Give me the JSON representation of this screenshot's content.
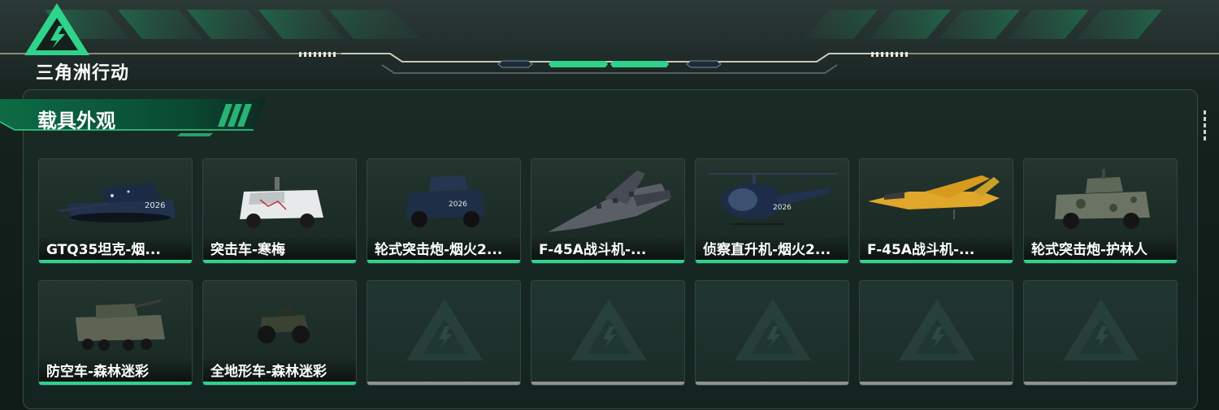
{
  "header": {
    "game_logo_text": "三角洲行动",
    "logo_icon": "delta-triangle-logo-icon"
  },
  "panel": {
    "title": "载具外观"
  },
  "vehicles": [
    {
      "name": "GTQ35坦克-烟...",
      "icon": "tank-icon"
    },
    {
      "name": "突击车-寒梅",
      "icon": "assault-vehicle-icon"
    },
    {
      "name": "轮式突击炮-烟火2...",
      "icon": "wheeled-assault-gun-icon"
    },
    {
      "name": "F-45A战斗机-...",
      "icon": "fighter-jet-icon"
    },
    {
      "name": "侦察直升机-烟火2...",
      "icon": "helicopter-icon"
    },
    {
      "name": "F-45A战斗机-...",
      "icon": "fighter-jet-yellow-icon"
    },
    {
      "name": "轮式突击炮-护林人",
      "icon": "wheeled-assault-gun-camo-icon"
    },
    {
      "name": "防空车-森林迷彩",
      "icon": "anti-air-vehicle-icon"
    },
    {
      "name": "全地形车-森林迷彩",
      "icon": "atv-icon"
    }
  ],
  "empty_slots": 5,
  "colors": {
    "accent": "#2fd38b",
    "empty_bar": "#8e9391",
    "background": "#13201c"
  }
}
